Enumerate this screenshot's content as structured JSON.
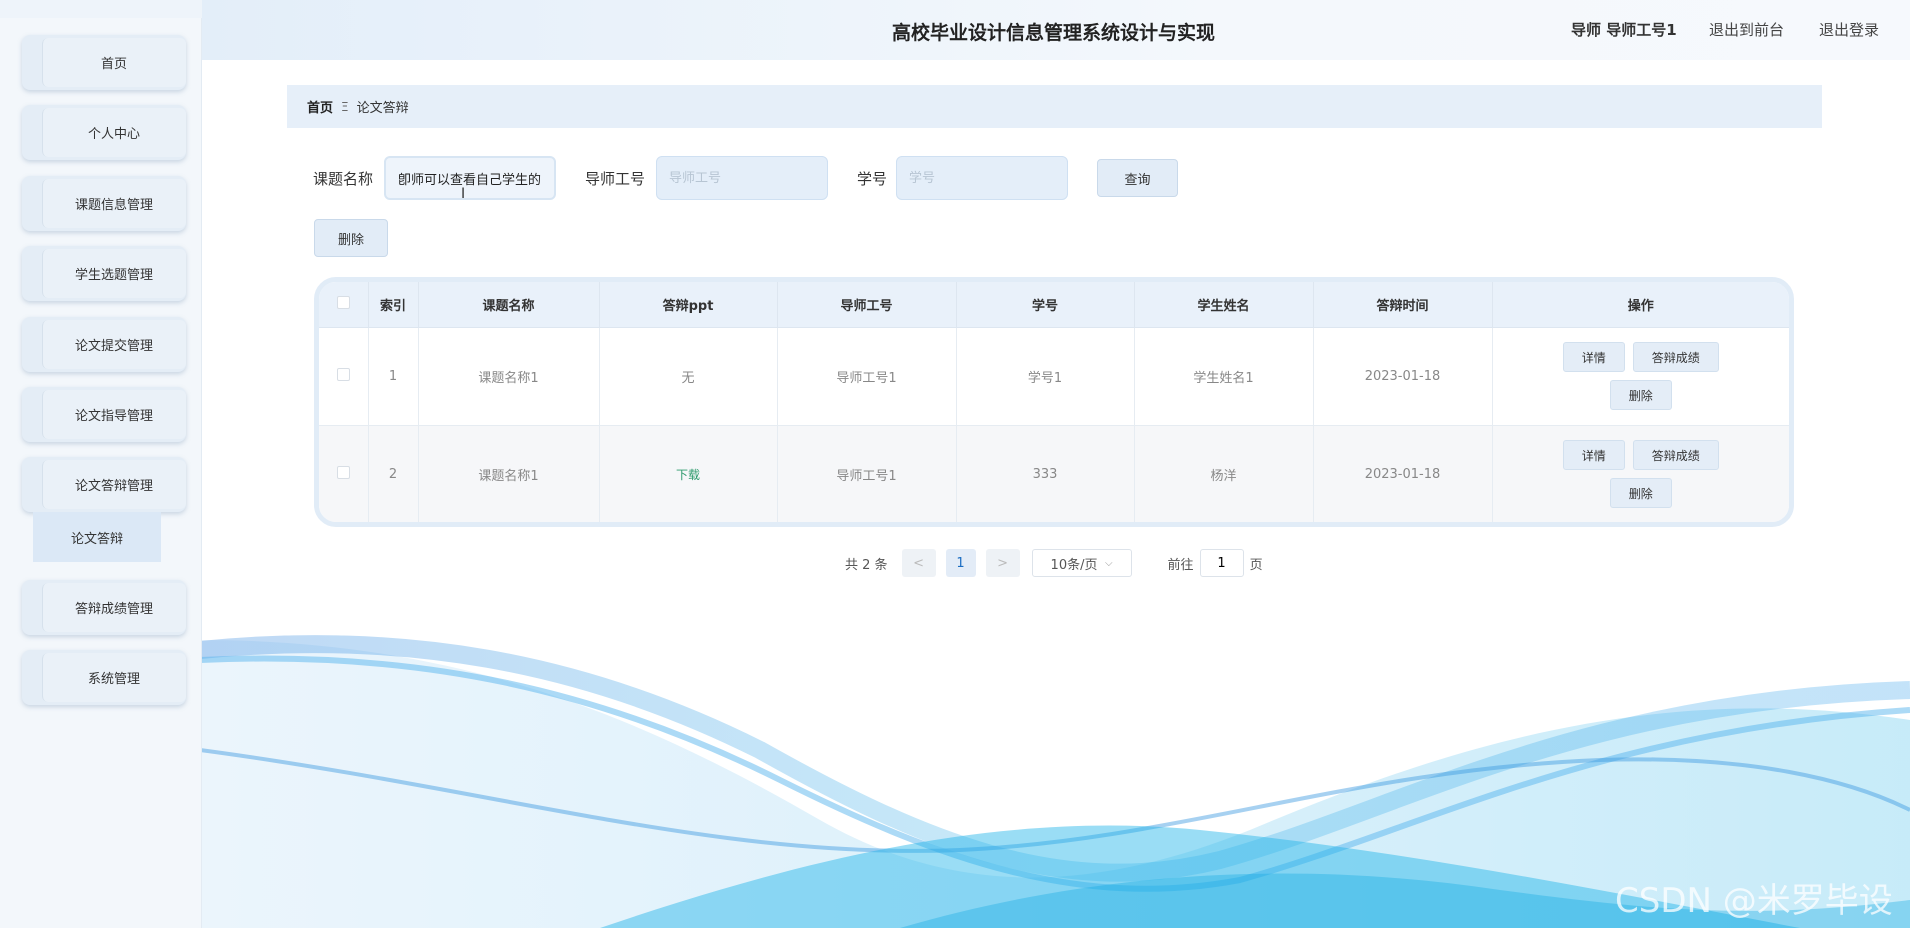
{
  "header": {
    "title": "高校毕业设计信息管理系统设计与实现",
    "user": "导师 导师工号1",
    "back_to_front": "退出到前台",
    "logout": "退出登录"
  },
  "sidebar": {
    "items": [
      {
        "label": "首页"
      },
      {
        "label": "个人中心"
      },
      {
        "label": "课题信息管理"
      },
      {
        "label": "学生选题管理"
      },
      {
        "label": "论文提交管理"
      },
      {
        "label": "论文指导管理"
      },
      {
        "label": "论文答辩管理"
      },
      {
        "label": "答辩成绩管理"
      },
      {
        "label": "系统管理"
      }
    ],
    "active_sub": "论文答辩"
  },
  "breadcrumb": {
    "home": "首页",
    "separator": "Ξ",
    "current": "论文答辩"
  },
  "search": {
    "topic_label": "课题名称",
    "topic_value": "卽师可以查看自己学生的",
    "teacher_label": "导师工号",
    "teacher_placeholder": "导师工号",
    "student_label": "学号",
    "student_placeholder": "学号",
    "query_button": "查询"
  },
  "toolbar": {
    "delete_button": "删除"
  },
  "table": {
    "headers": [
      "索引",
      "课题名称",
      "答辩ppt",
      "导师工号",
      "学号",
      "学生姓名",
      "答辩时间",
      "操作"
    ],
    "rows": [
      {
        "index": "1",
        "topic": "课题名称1",
        "ppt": "无",
        "teacher": "导师工号1",
        "student_no": "学号1",
        "student_name": "学生姓名1",
        "time": "2023-01-18"
      },
      {
        "index": "2",
        "topic": "课题名称1",
        "ppt": "下载",
        "teacher": "导师工号1",
        "student_no": "333",
        "student_name": "杨洋",
        "time": "2023-01-18"
      }
    ],
    "actions": {
      "detail": "详情",
      "score": "答辩成绩",
      "delete": "删除"
    }
  },
  "pagination": {
    "total": "共 2 条",
    "prev": "<",
    "current_page": "1",
    "next": ">",
    "page_size": "10条/页",
    "goto_prefix": "前往",
    "goto_value": "1",
    "goto_suffix": "页"
  },
  "watermark": "CSDN @米罗毕设",
  "colors": {
    "accent": "#e2ecf7",
    "download_link": "#2e9b6d",
    "wave": "#3aa2e6"
  }
}
